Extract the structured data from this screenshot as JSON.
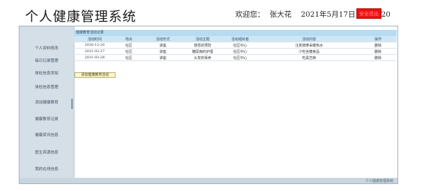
{
  "header": {
    "title": "个人健康管理系统",
    "welcome_label": "欢迎您：",
    "username": "张大花",
    "datetime": "2021年5月17日 20:43:20",
    "logout_label": "安全退出"
  },
  "sidebar": {
    "items": [
      {
        "label": "个人资料修改"
      },
      {
        "label": "每日记录管理"
      },
      {
        "label": "体检信息添加"
      },
      {
        "label": "体检信息管理"
      },
      {
        "label": "添加健康教育"
      },
      {
        "label": "健康教育记录"
      },
      {
        "label": "健康资讯信息"
      },
      {
        "label": "医生资源信息"
      },
      {
        "label": "我的在线信息"
      }
    ]
  },
  "main": {
    "section_title": "健康教育活动记录",
    "columns": [
      "活动时间",
      "地点",
      "活动形式",
      "活动主题",
      "活动组织者",
      "活动内容",
      "操作"
    ],
    "rows": [
      [
        "2020-12-20",
        "社区",
        "讲座",
        "感冒的预防",
        "社区中心",
        "注意按摩采暖热水",
        "删除"
      ],
      [
        "2021-02-27",
        "社区",
        "讲座",
        "糖尿病的护理",
        "社区中心",
        "少吃含糖食品",
        "删除"
      ],
      [
        "2021-03-28",
        "社区",
        "讲座",
        "头发的保养",
        "社区中心",
        "吃黑芝麻",
        "删除"
      ]
    ],
    "add_button_label": "添加健康教育活动"
  },
  "footer": {
    "text": "个人健康管理系统"
  },
  "colors": {
    "logout_bg": "#ee1111",
    "section_header_bg": "#b7dcf1",
    "sidebar_bg": "#d5dfe7",
    "add_button_bg": "#fbf7c8"
  }
}
